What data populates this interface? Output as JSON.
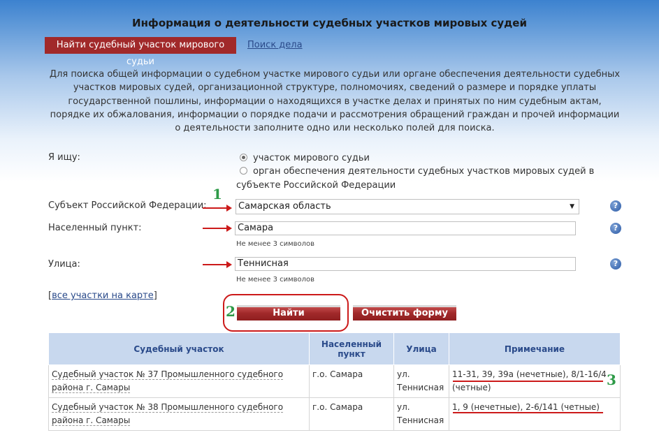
{
  "header": {
    "title": "Информация о деятельности судебных участков мировых судей",
    "tab_find": "Найти судебный участок мирового судьи",
    "tab_search": "Поиск дела"
  },
  "intro": "Для поиска общей информации о судебном участке мирового судьи или органе обеспечения деятельности судебных участков мировых судей, организационной структуре, полномочиях, сведений о размере и порядке уплаты государственной пошлины, информации о находящихся в участке делах и принятых по ним судебным актам, порядке их обжалования, информации о порядке подачи и рассмотрения обращений граждан и прочей информации о деятельности заполните одно или несколько полей для поиска.",
  "form": {
    "seek_label": "Я ищу:",
    "option1": "участок мирового судьи",
    "option2_line1": "орган обеспечения деятельности судебных участков мировых судей в",
    "option2_line2": "субъекте Российской Федерации",
    "subject_label": "Субъект Российской Федерации:",
    "subject_value": "Самарская область",
    "city_label": "Населенный пункт:",
    "city_value": "Самара",
    "city_hint": "Не менее 3 символов",
    "street_label": "Улица:",
    "street_value": "Теннисная",
    "street_hint": "Не менее 3 символов",
    "map_link_open": "[",
    "map_link": "все участки на карте",
    "map_link_close": "]",
    "find_button": "Найти",
    "clear_button": "Очистить форму",
    "help_glyph": "?",
    "dropdown_arrow": "▼"
  },
  "annotations": {
    "n1": "1",
    "n2": "2",
    "n3": "3"
  },
  "table": {
    "headers": [
      "Судебный участок",
      "Населенный пункт",
      "Улица",
      "Примечание"
    ],
    "rows": [
      {
        "court": "Судебный участок № 37 Промышленного судебного района г. Самары",
        "city": "г.о. Самара",
        "street": "ул. Теннисная",
        "note": "11-31, 39, 39а (нечетные), 8/1-16/4 (четные)"
      },
      {
        "court": "Судебный участок № 38 Промышленного судебного района г. Самары",
        "city": "г.о. Самара",
        "street": "ул. Теннисная",
        "note": "1, 9 (нечетные), 2-6/141 (четные)"
      }
    ]
  },
  "colors": {
    "accent": "#a1292a",
    "annotation_red": "#cc1a1a",
    "annotation_green": "#2d9a47",
    "table_header": "#c8d8ee"
  }
}
